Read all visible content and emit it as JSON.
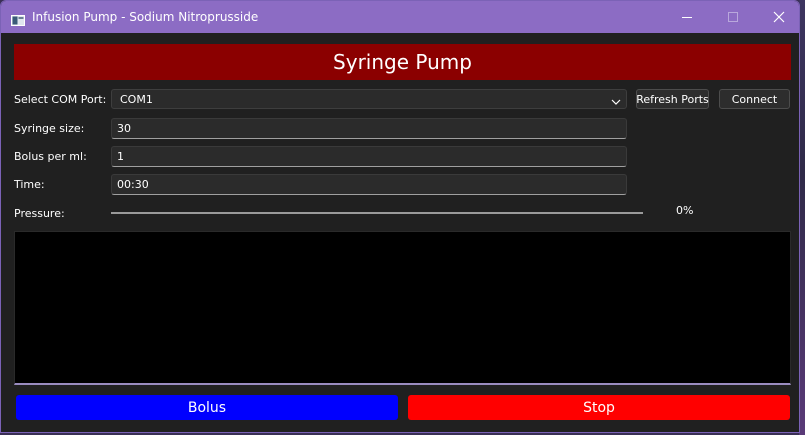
{
  "window": {
    "title": "Infusion Pump - Sodium Nitroprusside"
  },
  "header": {
    "title": "Syringe Pump"
  },
  "com_port": {
    "label": "Select COM Port:",
    "selected": "COM1",
    "refresh_label": "Refresh Ports",
    "connect_label": "Connect"
  },
  "syringe_size": {
    "label": "Syringe size:",
    "value": "30"
  },
  "bolus_per_ml": {
    "label": "Bolus per ml:",
    "value": "1"
  },
  "time": {
    "label": "Time:",
    "value": "00:30"
  },
  "pressure": {
    "label": "Pressure:",
    "percent_text": "0%",
    "value": 0
  },
  "log": {
    "content": ""
  },
  "actions": {
    "bolus_label": "Bolus",
    "stop_label": "Stop"
  },
  "colors": {
    "title_bar": "#8c6cc4",
    "header_bg": "#8b0000",
    "bolus_bg": "#0000ff",
    "stop_bg": "#ff0000",
    "window_bg": "#202020"
  },
  "icons": {
    "app": "app-window-icon",
    "minimize": "minimize-icon",
    "maximize": "maximize-icon",
    "close": "close-icon",
    "dropdown": "chevron-down-icon"
  }
}
